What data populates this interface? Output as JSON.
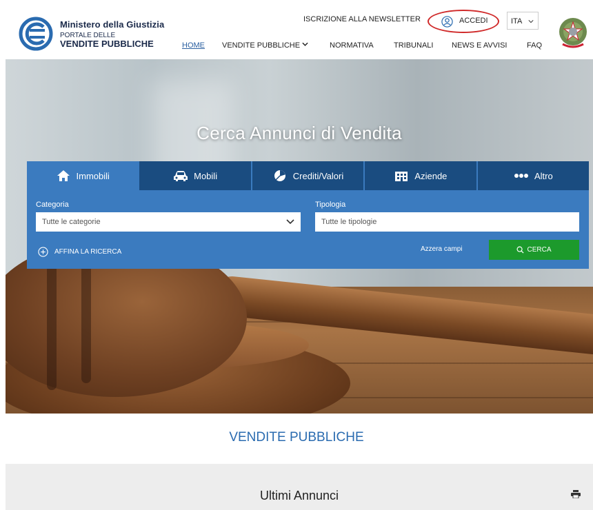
{
  "header": {
    "brand_line1": "Ministero della Giustizia",
    "brand_line2": "PORTALE DELLE",
    "brand_line3": "VENDITE PUBBLICHE",
    "newsletter": "ISCRIZIONE ALLA NEWSLETTER",
    "login": "ACCEDI",
    "language": "ITA",
    "nav": [
      {
        "label": "HOME",
        "active": true
      },
      {
        "label": "VENDITE PUBBLICHE",
        "dropdown": true
      },
      {
        "label": "NORMATIVA"
      },
      {
        "label": "TRIBUNALI"
      },
      {
        "label": "NEWS E AVVISI"
      },
      {
        "label": "FAQ"
      }
    ],
    "colors": {
      "brand": "#1b2a4a",
      "link_active": "#2a5fa0",
      "login_highlight": "#d02a2a"
    }
  },
  "hero": {
    "title": "Cerca Annunci di Vendita"
  },
  "search": {
    "tabs": [
      {
        "label": "Immobili",
        "icon": "house-icon",
        "active": true
      },
      {
        "label": "Mobili",
        "icon": "car-icon"
      },
      {
        "label": "Crediti/Valori",
        "icon": "pie-chart-icon"
      },
      {
        "label": "Aziende",
        "icon": "building-icon"
      },
      {
        "label": "Altro",
        "icon": "dots-icon"
      }
    ],
    "category_label": "Categoria",
    "category_value": "Tutte le categorie",
    "type_label": "Tipologia",
    "type_placeholder": "Tutte le tipologie",
    "refine": "AFFINA LA RICERCA",
    "reset": "Azzera campi",
    "submit": "CERCA",
    "colors": {
      "panel": "#3b7bbf",
      "tab": "#1a4c80",
      "submit": "#1c9a2c"
    }
  },
  "main": {
    "section_title": "VENDITE PUBBLICHE",
    "latest_title": "Ultimi Annunci"
  }
}
